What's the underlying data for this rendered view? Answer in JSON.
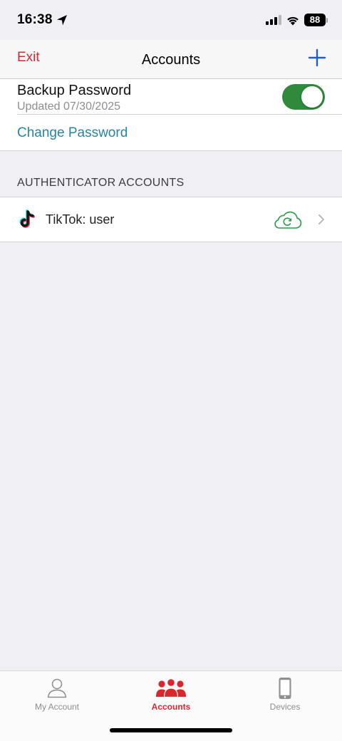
{
  "status_bar": {
    "time": "16:38",
    "battery": "88"
  },
  "nav": {
    "exit_label": "Exit",
    "title": "Accounts"
  },
  "backup": {
    "title": "Backup Password",
    "updated": "Updated 07/30/2025",
    "toggle_on": true,
    "change_password_label": "Change Password"
  },
  "accounts_section": {
    "header": "AUTHENTICATOR ACCOUNTS",
    "items": [
      {
        "name": "TikTok: user",
        "logo": "tiktok-logo",
        "status_icon": "cloud-sync-icon"
      }
    ]
  },
  "tabs": [
    {
      "label": "My Account",
      "icon": "person-icon",
      "active": false
    },
    {
      "label": "Accounts",
      "icon": "people-group-icon",
      "active": true
    },
    {
      "label": "Devices",
      "icon": "phone-icon",
      "active": false
    }
  ],
  "colors": {
    "accent_red": "#d8282d",
    "link_blue": "#2186a8",
    "add_blue": "#1f5fc4",
    "toggle_green": "#2f8a3c",
    "sync_green": "#2a9c4a"
  }
}
